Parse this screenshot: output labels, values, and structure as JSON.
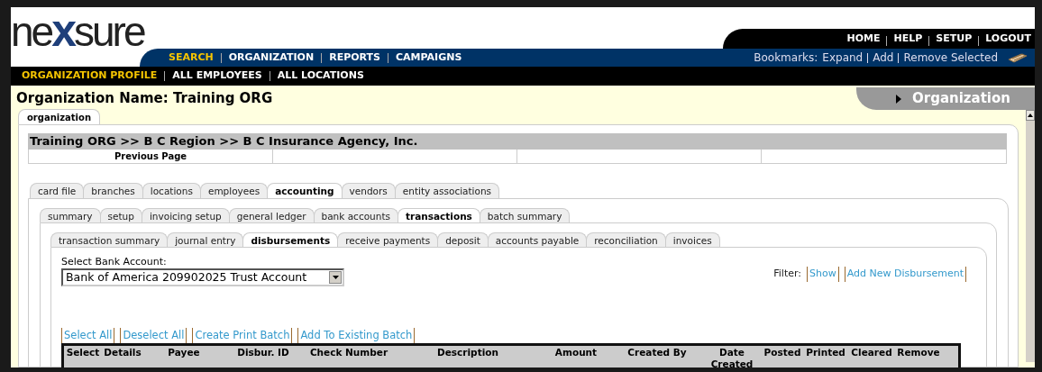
{
  "logo": {
    "parts": [
      {
        "text": "ne",
        "kind": "plain"
      },
      {
        "text": "x",
        "kind": "accent"
      },
      {
        "text": "sure",
        "kind": "plain"
      }
    ]
  },
  "top_links": [
    "HOME",
    "HELP",
    "SETUP",
    "LOGOUT"
  ],
  "main_nav": [
    {
      "label": "SEARCH",
      "selected": true
    },
    {
      "label": "ORGANIZATION",
      "selected": false
    },
    {
      "label": "REPORTS",
      "selected": false
    },
    {
      "label": "CAMPAIGNS",
      "selected": false
    }
  ],
  "bookmarks": {
    "label": "Bookmarks:",
    "links": [
      "Expand",
      "Add",
      "Remove Selected"
    ]
  },
  "sub_nav": [
    {
      "label": "ORGANIZATION PROFILE",
      "selected": true
    },
    {
      "label": "ALL EMPLOYEES",
      "selected": false
    },
    {
      "label": "ALL LOCATIONS",
      "selected": false
    }
  ],
  "page_title": "Organization Name: Training ORG",
  "section_tab": "Organization",
  "outer_tab": {
    "label": "organization",
    "selected": true
  },
  "breadcrumb": "Training ORG >> B C Region >> B C Insurance Agency, Inc.",
  "previous_page": "Previous Page",
  "tabs_1": [
    {
      "label": "card file",
      "selected": false
    },
    {
      "label": "branches",
      "selected": false
    },
    {
      "label": "locations",
      "selected": false
    },
    {
      "label": "employees",
      "selected": false
    },
    {
      "label": "accounting",
      "selected": true
    },
    {
      "label": "vendors",
      "selected": false
    },
    {
      "label": "entity associations",
      "selected": false
    }
  ],
  "tabs_2": [
    {
      "label": "summary",
      "selected": false
    },
    {
      "label": "setup",
      "selected": false
    },
    {
      "label": "invoicing setup",
      "selected": false
    },
    {
      "label": "general ledger",
      "selected": false
    },
    {
      "label": "bank accounts",
      "selected": false
    },
    {
      "label": "transactions",
      "selected": true
    },
    {
      "label": "batch summary",
      "selected": false
    }
  ],
  "tabs_3": [
    {
      "label": "transaction summary",
      "selected": false
    },
    {
      "label": "journal entry",
      "selected": false
    },
    {
      "label": "disbursements",
      "selected": true
    },
    {
      "label": "receive payments",
      "selected": false
    },
    {
      "label": "deposit",
      "selected": false
    },
    {
      "label": "accounts payable",
      "selected": false
    },
    {
      "label": "reconciliation",
      "selected": false
    },
    {
      "label": "invoices",
      "selected": false
    }
  ],
  "bank_account": {
    "label": "Select Bank Account:",
    "value": "Bank of America 209902025 Trust Account"
  },
  "filter": {
    "label": "Filter:",
    "links": [
      "Show",
      "Add New Disbursement"
    ]
  },
  "actions": [
    "Select All",
    "Deselect All",
    "Create Print Batch",
    "Add To Existing Batch"
  ],
  "table": {
    "columns": [
      "Select",
      "Details",
      "Payee",
      "Disbur. ID",
      "Check Number",
      "Description",
      "Amount",
      "Created By",
      "Date Created",
      "Posted",
      "Printed",
      "Cleared",
      "Remove"
    ]
  }
}
